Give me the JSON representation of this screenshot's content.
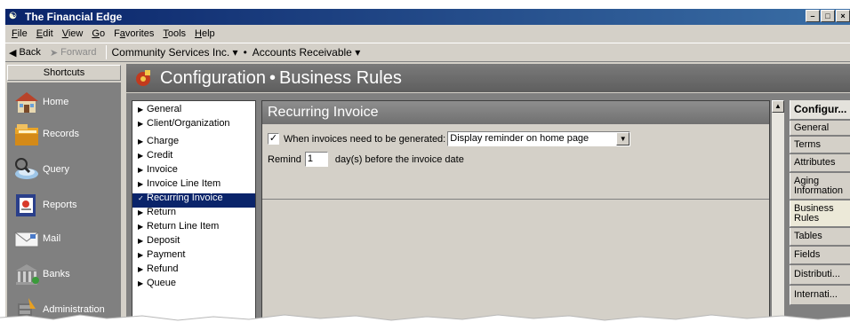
{
  "window": {
    "title": "The Financial Edge",
    "app_icon": "app-logo-icon",
    "buttons": [
      "minimize",
      "maximize",
      "close"
    ]
  },
  "menubar": {
    "items": [
      {
        "pre": "",
        "key": "F",
        "post": "ile"
      },
      {
        "pre": "",
        "key": "E",
        "post": "dit"
      },
      {
        "pre": "",
        "key": "V",
        "post": "iew"
      },
      {
        "pre": "",
        "key": "G",
        "post": "o"
      },
      {
        "pre": "F",
        "key": "a",
        "post": "vorites"
      },
      {
        "pre": "",
        "key": "T",
        "post": "ools"
      },
      {
        "pre": "",
        "key": "H",
        "post": "elp"
      }
    ]
  },
  "navbar": {
    "back_label": "Back",
    "forward_label": "Forward",
    "org": "Community Services Inc.",
    "org_caret": "▾",
    "separator": "•",
    "module": "Accounts Receivable",
    "module_caret": "▾"
  },
  "sidebar": {
    "header": "Shortcuts",
    "items": [
      {
        "label": "Home",
        "icon": "home-icon"
      },
      {
        "label": "Records",
        "icon": "records-icon"
      },
      {
        "label": "Query",
        "icon": "query-icon"
      },
      {
        "label": "Reports",
        "icon": "reports-icon"
      },
      {
        "label": "Mail",
        "icon": "mail-icon"
      },
      {
        "label": "Banks",
        "icon": "banks-icon"
      },
      {
        "label": "Administration",
        "icon": "administration-icon"
      }
    ]
  },
  "header": {
    "title_part1": "Configuration",
    "title_sep": "•",
    "title_part2": "Business Rules"
  },
  "tree": {
    "items": [
      {
        "label": "General",
        "selected": false
      },
      {
        "label": "Client/Organization",
        "selected": false
      },
      {
        "label": "Charge",
        "selected": false
      },
      {
        "label": "Credit",
        "selected": false
      },
      {
        "label": "Invoice",
        "selected": false
      },
      {
        "label": "Invoice Line Item",
        "selected": false
      },
      {
        "label": "Recurring Invoice",
        "selected": true
      },
      {
        "label": "Return",
        "selected": false
      },
      {
        "label": "Return Line Item",
        "selected": false
      },
      {
        "label": "Deposit",
        "selected": false
      },
      {
        "label": "Payment",
        "selected": false
      },
      {
        "label": "Refund",
        "selected": false
      },
      {
        "label": "Queue",
        "selected": false
      }
    ]
  },
  "panel": {
    "title": "Recurring Invoice",
    "checkbox_checked": true,
    "checkbox_label": "When invoices need to be generated:",
    "dropdown_value": "Display reminder on home page",
    "remind_label": "Remind",
    "remind_value": "1",
    "remind_suffix": "day(s) before the invoice date"
  },
  "right_tabs": {
    "header": "Configur...",
    "items": [
      {
        "label": "General",
        "label2": ""
      },
      {
        "label": "Terms",
        "label2": ""
      },
      {
        "label": "Attributes",
        "label2": ""
      },
      {
        "label": "Aging",
        "label2": "Information"
      },
      {
        "label": "Business",
        "label2": "Rules"
      },
      {
        "label": "Tables",
        "label2": ""
      },
      {
        "label": "Fields",
        "label2": ""
      },
      {
        "label": "Distributi...",
        "label2": ""
      },
      {
        "label": "Internati...",
        "label2": ""
      }
    ]
  }
}
